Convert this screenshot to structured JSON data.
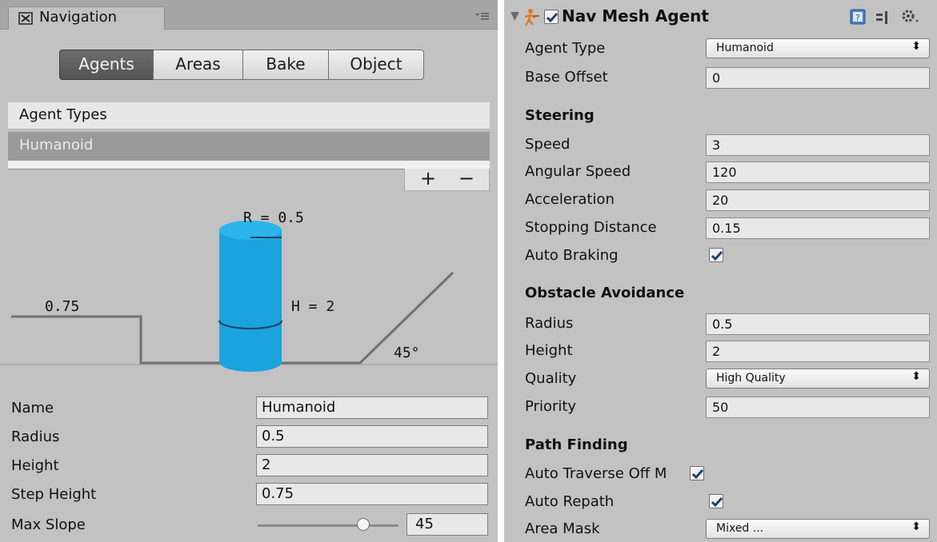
{
  "navigation": {
    "tab_title": "Navigation",
    "tabs": [
      "Agents",
      "Areas",
      "Bake",
      "Object"
    ],
    "active_tab": "Agents",
    "agent_types_header": "Agent Types",
    "agent_types": [
      "Humanoid"
    ],
    "add_button": "+",
    "remove_button": "−",
    "diagram": {
      "radius_label": "R = 0.5",
      "height_label": "H = 2",
      "step_label": "0.75",
      "slope_label": "45°"
    },
    "fields": {
      "name": {
        "label": "Name",
        "value": "Humanoid"
      },
      "radius": {
        "label": "Radius",
        "value": "0.5"
      },
      "height": {
        "label": "Height",
        "value": "2"
      },
      "step_height": {
        "label": "Step Height",
        "value": "0.75"
      },
      "max_slope": {
        "label": "Max Slope",
        "value": "45",
        "slider_fraction": 0.75
      }
    }
  },
  "nav_mesh_agent": {
    "title": "Nav Mesh Agent",
    "enabled": true,
    "agent_type": {
      "label": "Agent Type",
      "value": "Humanoid"
    },
    "base_offset": {
      "label": "Base Offset",
      "value": "0"
    },
    "steering": {
      "header": "Steering",
      "speed": {
        "label": "Speed",
        "value": "3"
      },
      "angular_speed": {
        "label": "Angular Speed",
        "value": "120"
      },
      "acceleration": {
        "label": "Acceleration",
        "value": "20"
      },
      "stopping_distance": {
        "label": "Stopping Distance",
        "value": "0.15"
      },
      "auto_braking": {
        "label": "Auto Braking",
        "checked": true
      }
    },
    "obstacle_avoidance": {
      "header": "Obstacle Avoidance",
      "radius": {
        "label": "Radius",
        "value": "0.5"
      },
      "height": {
        "label": "Height",
        "value": "2"
      },
      "quality": {
        "label": "Quality",
        "value": "High Quality"
      },
      "priority": {
        "label": "Priority",
        "value": "50"
      }
    },
    "path_finding": {
      "header": "Path Finding",
      "auto_traverse": {
        "label": "Auto Traverse Off M",
        "checked": true
      },
      "auto_repath": {
        "label": "Auto Repath",
        "checked": true
      },
      "area_mask": {
        "label": "Area Mask",
        "value": "Mixed ..."
      }
    }
  },
  "colors": {
    "panel_bg": "#c2c2c2",
    "agent_cylinder": "#1aa3dd",
    "active_tab": "#5e5e5e"
  },
  "icons": [
    "navigation-icon",
    "panel-menu-icon",
    "foldout-arrow-icon",
    "nav-agent-icon",
    "help-icon",
    "preset-icon",
    "gear-icon",
    "checkmark-icon",
    "dropdown-arrow-icon"
  ]
}
